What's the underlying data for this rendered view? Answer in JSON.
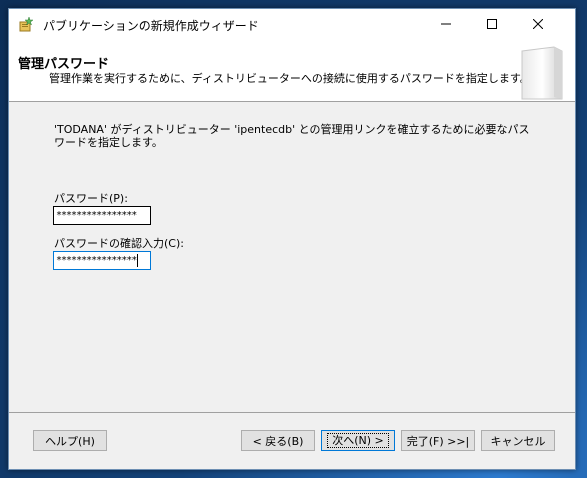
{
  "window": {
    "title": "パブリケーションの新規作成ウィザード",
    "controls": {
      "minimize": "—",
      "maximize": "☐",
      "close": "✕"
    }
  },
  "header": {
    "title": "管理パスワード",
    "subtitle": "管理作業を実行するために、ディストリビューターへの接続に使用するパスワードを指定します。"
  },
  "content": {
    "description": "'TODANA' がディストリビューター 'ipentecdb' との管理用リンクを確立するために必要なパスワードを指定します。",
    "password_label": "パスワード(P):",
    "password_value": "****************",
    "confirm_label": "パスワードの確認入力(C):",
    "confirm_value": "****************"
  },
  "buttons": {
    "help": "ヘルプ(H)",
    "back": "< 戻る(B)",
    "next": "次へ(N) >",
    "finish": "完了(F) >>|",
    "cancel": "キャンセル"
  }
}
